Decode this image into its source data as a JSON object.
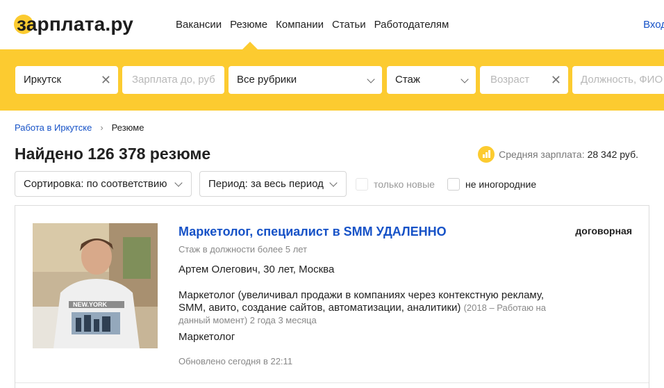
{
  "header": {
    "logo": "зарплата.ру",
    "nav": [
      "Вакансии",
      "Резюме",
      "Компании",
      "Статьи",
      "Работодателям"
    ],
    "login": "Вход"
  },
  "search": {
    "city": "Иркутск",
    "salary_placeholder": "Зарплата до, руб",
    "rubric": "Все рубрики",
    "experience": "Стаж",
    "age_placeholder": "Возраст",
    "position_placeholder": "Должность, ФИО"
  },
  "breadcrumb": {
    "parent": "Работа в Иркутске",
    "current": "Резюме"
  },
  "results": {
    "title": "Найдено 126 378 резюме",
    "avg_label": "Средняя зарплата:",
    "avg_value": "28 342 руб."
  },
  "filters": {
    "sort": "Сортировка: по соответствию",
    "period": "Период: за весь период",
    "only_new": "только новые",
    "not_nonresident": "не иногородние"
  },
  "resume": {
    "title": "Маркетолог, специалист в SMM УДАЛЕННО",
    "salary": "договорная",
    "experience": "Стаж в должности более 5 лет",
    "person": "Артем Олегович, 30 лет, Москва",
    "description": "Маркетолог (увеличивал продажи в компаниях через контекстную рекламу, SMM, авито, создание сайтов, автоматизации, аналитики)",
    "description_period": "(2018 – Работаю на данный момент) 2 года 3 месяца",
    "position": "Маркетолог",
    "updated": "Обновлено сегодня в 22:11",
    "shirt_text": "NEW.YORK"
  },
  "colors": {
    "brand_yellow": "#fccb30",
    "link_blue": "#1652c7"
  }
}
